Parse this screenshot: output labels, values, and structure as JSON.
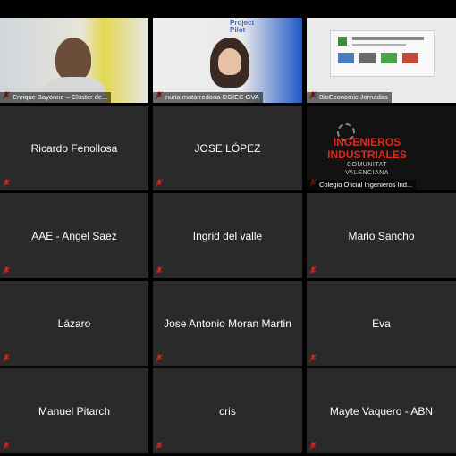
{
  "participants": [
    {
      "id": "p1",
      "label": "Enrique Bayonne – Clúster de...",
      "type": "video",
      "speaking": false
    },
    {
      "id": "p2",
      "label": "nuria matarredona-DGIEC GVA",
      "type": "video",
      "video_text": "Project Pilot",
      "speaking": false
    },
    {
      "id": "p3",
      "label": "BioEconomic Jornadas",
      "type": "video",
      "speaking": false
    },
    {
      "id": "p4",
      "name": "Ricardo Fenollosa",
      "type": "name"
    },
    {
      "id": "p5",
      "name": "JOSE LÓPEZ",
      "type": "name"
    },
    {
      "id": "p6",
      "label": "Colegio Oficial Ingenieros Ind...",
      "type": "video",
      "brand_title": "INGENIEROS INDUSTRIALES",
      "brand_sub": "COMUNITAT VALENCIANA"
    },
    {
      "id": "p7",
      "name": "AAE - Angel Saez",
      "type": "name"
    },
    {
      "id": "p8",
      "name": "Ingrid del valle",
      "type": "name"
    },
    {
      "id": "p9",
      "name": "Mario Sancho",
      "type": "name"
    },
    {
      "id": "p10",
      "name": "Lázaro",
      "type": "name"
    },
    {
      "id": "p11",
      "name": "Jose Antonio Moran Martin",
      "type": "name"
    },
    {
      "id": "p12",
      "name": "Eva",
      "type": "name"
    },
    {
      "id": "p13",
      "name": "Manuel Pitarch",
      "type": "name"
    },
    {
      "id": "p14",
      "name": "cris",
      "type": "name"
    },
    {
      "id": "p15",
      "name": "Mayte Vaquero - ABN",
      "type": "name"
    }
  ],
  "colors": {
    "tile_bg": "#2a2a2a",
    "muted_mic": "#e0241a",
    "background": "#000000"
  },
  "icons": {
    "mic": "microphone-muted-icon"
  }
}
